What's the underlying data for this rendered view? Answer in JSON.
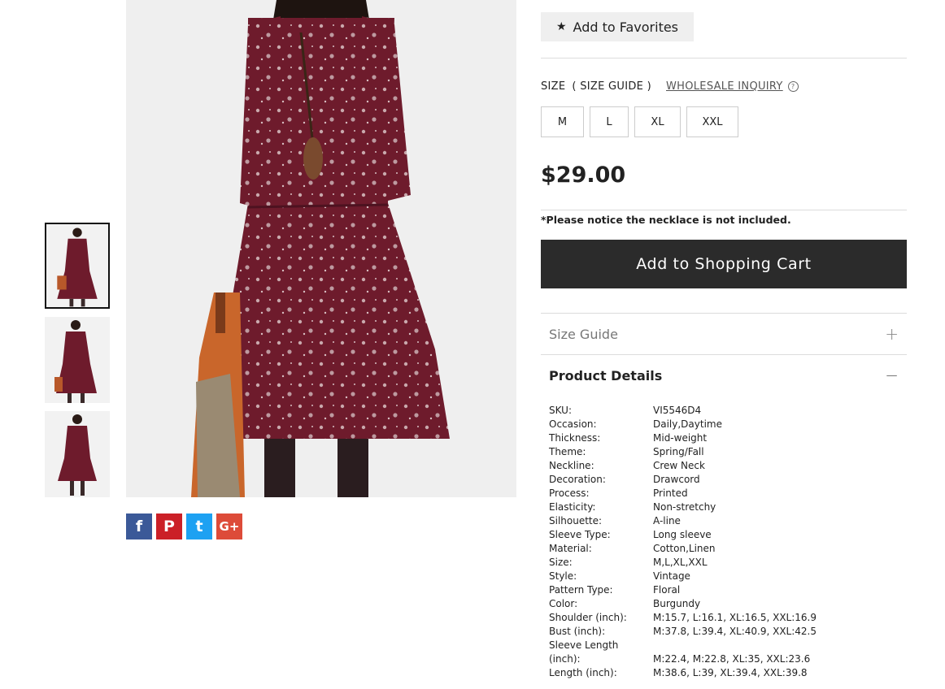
{
  "favorites_label": "Add to Favorites",
  "size_label": "SIZE",
  "size_guide_link": "( SIZE GUIDE )",
  "wholesale_label": "WHOLESALE INQUIRY",
  "sizes": [
    "M",
    "L",
    "XL",
    "XXL"
  ],
  "price": "$29.00",
  "notice": "*Please notice the necklace is not included.",
  "cart_label": "Add to Shopping Cart",
  "accordion": {
    "size_guide": "Size Guide",
    "product_details": "Product Details"
  },
  "share": {
    "facebook": "f",
    "pinterest": "P",
    "twitter": "t",
    "googleplus": "G+"
  },
  "details": [
    {
      "k": "SKU:",
      "v": "VI5546D4"
    },
    {
      "k": "Occasion:",
      "v": "Daily,Daytime"
    },
    {
      "k": "Thickness:",
      "v": "Mid-weight"
    },
    {
      "k": "Theme:",
      "v": "Spring/Fall"
    },
    {
      "k": "Neckline:",
      "v": "Crew Neck"
    },
    {
      "k": "Decoration:",
      "v": "Drawcord"
    },
    {
      "k": "Process:",
      "v": "Printed"
    },
    {
      "k": "Elasticity:",
      "v": "Non-stretchy"
    },
    {
      "k": "Silhouette:",
      "v": "A-line"
    },
    {
      "k": "Sleeve Type:",
      "v": "Long sleeve"
    },
    {
      "k": "Material:",
      "v": "Cotton,Linen"
    },
    {
      "k": "Size:",
      "v": "M,L,XL,XXL"
    },
    {
      "k": "Style:",
      "v": "Vintage"
    },
    {
      "k": "Pattern Type:",
      "v": "Floral"
    },
    {
      "k": "Color:",
      "v": "Burgundy"
    },
    {
      "k": "Shoulder (inch):",
      "v": "M:15.7, L:16.1, XL:16.5, XXL:16.9"
    },
    {
      "k": "Bust (inch):",
      "v": "M:37.8, L:39.4, XL:40.9, XXL:42.5"
    },
    {
      "k": "Sleeve Length (inch):",
      "v": "M:22.4, M:22.8, XL:35, XXL:23.6"
    },
    {
      "k": "Length (inch):",
      "v": "M:38.6, L:39, XL:39.4, XXL:39.8"
    }
  ],
  "colors": {
    "dress": "#6e1b2c",
    "cart_button": "#2b2b2b",
    "facebook": "#3b5998",
    "pinterest": "#cb2027",
    "twitter": "#1da1f2",
    "googleplus": "#dd4b39"
  }
}
